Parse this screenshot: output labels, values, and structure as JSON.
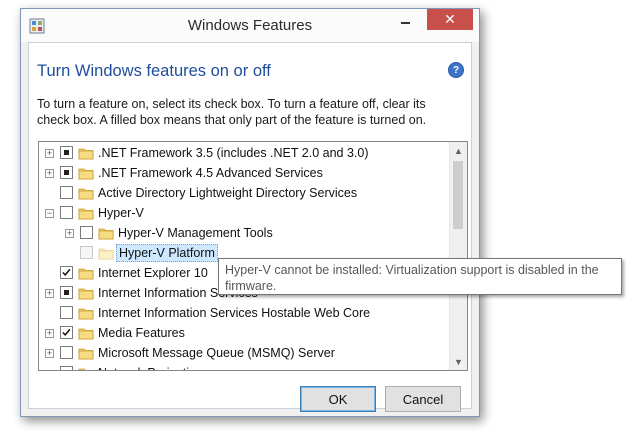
{
  "window": {
    "title": "Windows Features",
    "close_glyph": "✕",
    "icon": "windows-features-icon"
  },
  "main": {
    "heading": "Turn Windows features on or off",
    "description": "To turn a feature on, select its check box. To turn a feature off, clear its check box. A filled box means that only part of the feature is turned on.",
    "help_glyph": "?"
  },
  "features": [
    {
      "label": ".NET Framework 3.5 (includes .NET 2.0 and 3.0)",
      "expander": "+",
      "state": "partial",
      "level": 0
    },
    {
      "label": ".NET Framework 4.5 Advanced Services",
      "expander": "+",
      "state": "partial",
      "level": 0
    },
    {
      "label": "Active Directory Lightweight Directory Services",
      "expander": "",
      "state": "unchecked",
      "level": 0
    },
    {
      "label": "Hyper-V",
      "expander": "−",
      "state": "unchecked",
      "level": 0
    },
    {
      "label": "Hyper-V Management Tools",
      "expander": "+",
      "state": "unchecked",
      "level": 1
    },
    {
      "label": "Hyper-V Platform",
      "expander": "",
      "state": "disabled",
      "level": 1,
      "selected": true
    },
    {
      "label": "Internet Explorer 10",
      "expander": "",
      "state": "checked",
      "level": 0
    },
    {
      "label": "Internet Information Services",
      "expander": "+",
      "state": "partial",
      "level": 0
    },
    {
      "label": "Internet Information Services Hostable Web Core",
      "expander": "",
      "state": "unchecked",
      "level": 0
    },
    {
      "label": "Media Features",
      "expander": "+",
      "state": "checked",
      "level": 0
    },
    {
      "label": "Microsoft Message Queue (MSMQ) Server",
      "expander": "+",
      "state": "unchecked",
      "level": 0
    },
    {
      "label": "Network Projection",
      "expander": "",
      "state": "unchecked",
      "level": 0
    }
  ],
  "tooltip": {
    "text": "Hyper-V cannot be installed: Virtualization support is disabled in the firmware."
  },
  "buttons": {
    "ok_label": "OK",
    "cancel_label": "Cancel"
  },
  "scrollbar": {
    "up_glyph": "▲",
    "down_glyph": "▼"
  }
}
